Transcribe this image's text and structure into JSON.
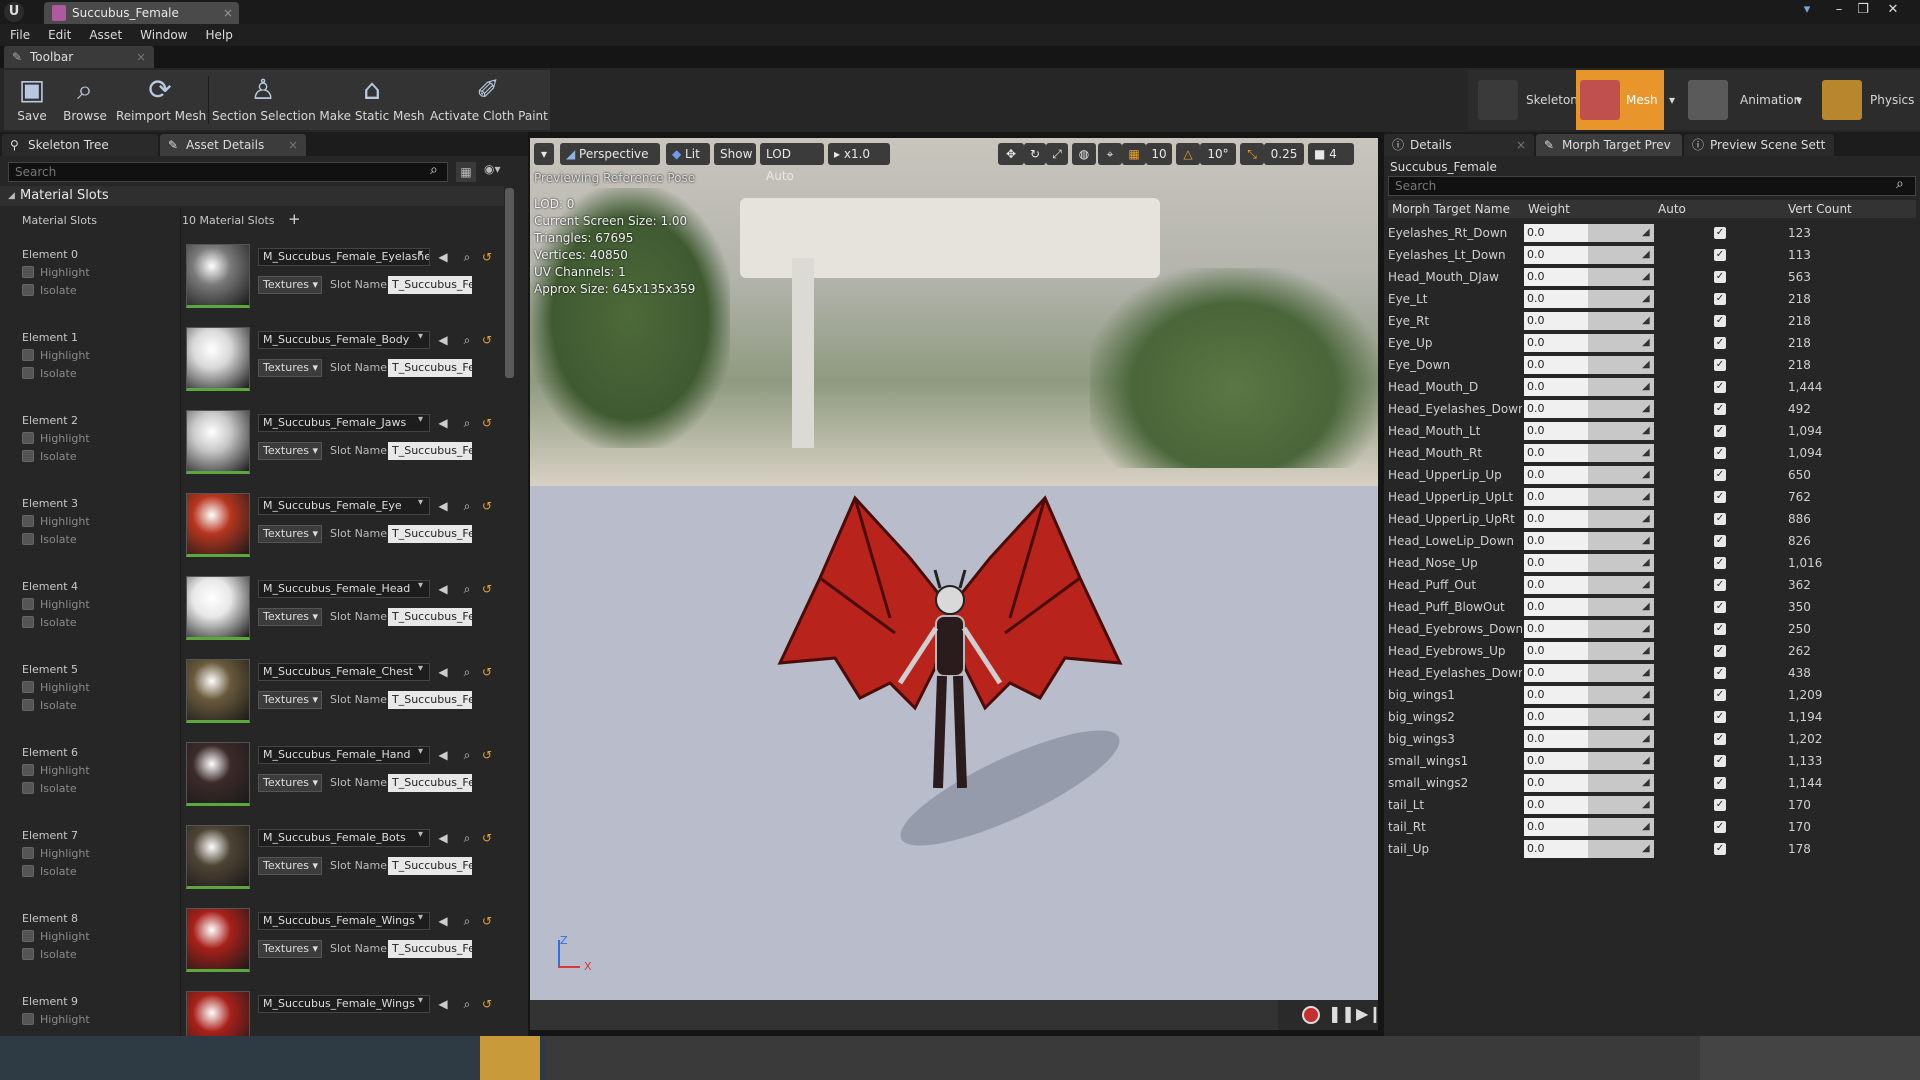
{
  "window": {
    "tab_title": "Succubus_Female"
  },
  "menu": [
    "File",
    "Edit",
    "Asset",
    "Window",
    "Help"
  ],
  "toolbar": {
    "tab_label": "Toolbar",
    "buttons": [
      {
        "label": "Save",
        "icon": "save-icon"
      },
      {
        "label": "Browse",
        "icon": "browse-icon"
      },
      {
        "label": "Reimport Mesh",
        "icon": "reimport-icon"
      },
      {
        "label": "Section Selection",
        "icon": "section-selection-icon"
      },
      {
        "label": "Make Static Mesh",
        "icon": "static-mesh-icon"
      },
      {
        "label": "Activate Cloth Paint",
        "icon": "paint-brush-icon"
      }
    ]
  },
  "modes": [
    {
      "label": "Skeleton",
      "active": false
    },
    {
      "label": "Mesh",
      "active": true
    },
    {
      "label": "Animation",
      "active": false
    },
    {
      "label": "Physics",
      "active": false
    }
  ],
  "left_panel": {
    "tabs": [
      "Skeleton Tree",
      "Asset Details"
    ],
    "search_placeholder": "Search",
    "section": "Material Slots",
    "slots_label": "Material Slots",
    "slots_count": "10 Material Slots",
    "highlight_label": "Highlight",
    "isolate_label": "Isolate",
    "textures_label": "Textures",
    "slot_name_label": "Slot Name",
    "elements": [
      {
        "name": "Element 0",
        "material": "M_Succubus_Female_Eyelashes",
        "slot": "T_Succubus_Fe"
      },
      {
        "name": "Element 1",
        "material": "M_Succubus_Female_Body",
        "slot": "T_Succubus_Fe"
      },
      {
        "name": "Element 2",
        "material": "M_Succubus_Female_Jaws",
        "slot": "T_Succubus_Fe"
      },
      {
        "name": "Element 3",
        "material": "M_Succubus_Female_Eye",
        "slot": "T_Succubus_Fe"
      },
      {
        "name": "Element 4",
        "material": "M_Succubus_Female_Head",
        "slot": "T_Succubus_Fe"
      },
      {
        "name": "Element 5",
        "material": "M_Succubus_Female_Chest",
        "slot": "T_Succubus_Fe"
      },
      {
        "name": "Element 6",
        "material": "M_Succubus_Female_Hand",
        "slot": "T_Succubus_Fe"
      },
      {
        "name": "Element 7",
        "material": "M_Succubus_Female_Bots",
        "slot": "T_Succubus_Fe"
      },
      {
        "name": "Element 8",
        "material": "M_Succubus_Female_Wings",
        "slot": "T_Succubus_Fe"
      },
      {
        "name": "Element 9",
        "material": "M_Succubus_Female_Wings",
        "slot": ""
      }
    ],
    "thumb_colors": [
      "#7a7a7a",
      "#d9d9d9",
      "#c9c9c9",
      "#b8361f",
      "#e8e8e8",
      "#6a5a3c",
      "#3d2a2a",
      "#4e4434",
      "#a8201a",
      "#a8201a"
    ]
  },
  "viewport": {
    "view_mode": "Perspective",
    "lighting": "Lit",
    "show": "Show",
    "lod": "LOD Auto",
    "speed": "x1.0",
    "grid_snap": "10",
    "rot_snap": "10°",
    "scale_snap": "0.25",
    "cam_speed": "4",
    "preview_note": "Previewing Reference Pose",
    "stats": [
      "LOD: 0",
      "Current Screen Size: 1.00",
      "Triangles: 67695",
      "Vertices: 40850",
      "UV Channels: 1",
      "Approx Size: 645x135x359"
    ],
    "axis_z": "Z",
    "axis_x": "X"
  },
  "right_panel": {
    "tabs": [
      "Details",
      "Morph Target Prev",
      "Preview Scene Sett"
    ],
    "asset_name": "Succubus_Female",
    "search_placeholder": "Search",
    "columns": [
      "Morph Target Name",
      "Weight",
      "Auto",
      "Vert Count"
    ],
    "morphs": [
      {
        "name": "Eyelashes_Rt_Down",
        "weight": "0.0",
        "verts": "123"
      },
      {
        "name": "Eyelashes_Lt_Down",
        "weight": "0.0",
        "verts": "113"
      },
      {
        "name": "Head_Mouth_DJaw",
        "weight": "0.0",
        "verts": "563"
      },
      {
        "name": "Eye_Lt",
        "weight": "0.0",
        "verts": "218"
      },
      {
        "name": "Eye_Rt",
        "weight": "0.0",
        "verts": "218"
      },
      {
        "name": "Eye_Up",
        "weight": "0.0",
        "verts": "218"
      },
      {
        "name": "Eye_Down",
        "weight": "0.0",
        "verts": "218"
      },
      {
        "name": "Head_Mouth_D",
        "weight": "0.0",
        "verts": "1,444"
      },
      {
        "name": "Head_Eyelashes_DownR",
        "weight": "0.0",
        "verts": "492"
      },
      {
        "name": "Head_Mouth_Lt",
        "weight": "0.0",
        "verts": "1,094"
      },
      {
        "name": "Head_Mouth_Rt",
        "weight": "0.0",
        "verts": "1,094"
      },
      {
        "name": "Head_UpperLip_Up",
        "weight": "0.0",
        "verts": "650"
      },
      {
        "name": "Head_UpperLip_UpLt",
        "weight": "0.0",
        "verts": "762"
      },
      {
        "name": "Head_UpperLip_UpRt",
        "weight": "0.0",
        "verts": "886"
      },
      {
        "name": "Head_LoweLip_Down",
        "weight": "0.0",
        "verts": "826"
      },
      {
        "name": "Head_Nose_Up",
        "weight": "0.0",
        "verts": "1,016"
      },
      {
        "name": "Head_Puff_Out",
        "weight": "0.0",
        "verts": "362"
      },
      {
        "name": "Head_Puff_BlowOut",
        "weight": "0.0",
        "verts": "350"
      },
      {
        "name": "Head_Eyebrows_Down",
        "weight": "0.0",
        "verts": "250"
      },
      {
        "name": "Head_Eyebrows_Up",
        "weight": "0.0",
        "verts": "262"
      },
      {
        "name": "Head_Eyelashes_DownL",
        "weight": "0.0",
        "verts": "438"
      },
      {
        "name": "big_wings1",
        "weight": "0.0",
        "verts": "1,209"
      },
      {
        "name": "big_wings2",
        "weight": "0.0",
        "verts": "1,194"
      },
      {
        "name": "big_wings3",
        "weight": "0.0",
        "verts": "1,202"
      },
      {
        "name": "small_wings1",
        "weight": "0.0",
        "verts": "1,133"
      },
      {
        "name": "small_wings2",
        "weight": "0.0",
        "verts": "1,144"
      },
      {
        "name": "tail_Lt",
        "weight": "0.0",
        "verts": "170"
      },
      {
        "name": "tail_Rt",
        "weight": "0.0",
        "verts": "170"
      },
      {
        "name": "tail_Up",
        "weight": "0.0",
        "verts": "178"
      }
    ]
  },
  "colors": {
    "accent_orange": "#e8a030",
    "active_mode": "#f0a030",
    "green_bar": "#5ca73e"
  }
}
